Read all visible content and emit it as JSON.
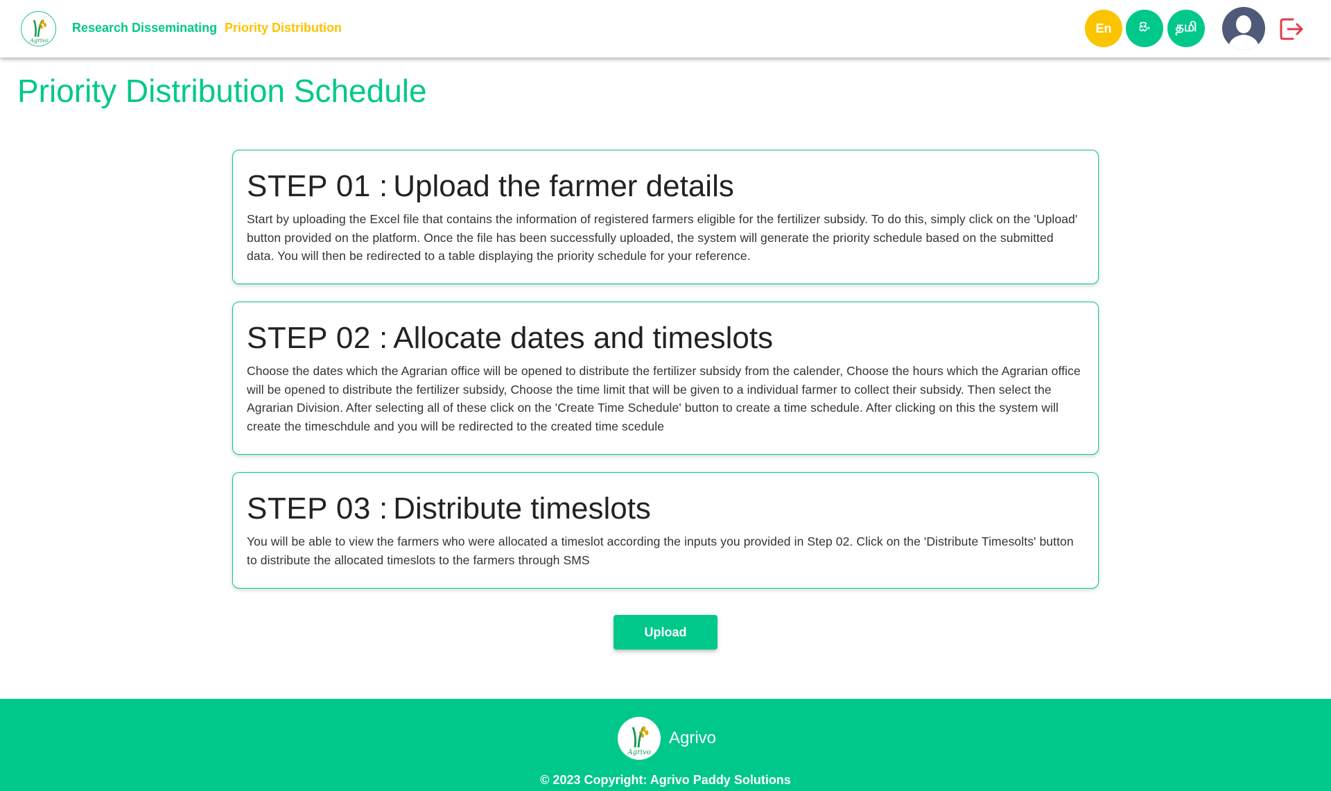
{
  "colors": {
    "brand_green": "#00c88a",
    "accent_yellow": "#fbc400",
    "text_dark": "#222222",
    "logout_red": "#e03c4a",
    "avatar_bg": "#4e5a78"
  },
  "header": {
    "logo_icon": "agrivo-logo-icon",
    "logo_text": "Agrivo",
    "nav": {
      "research": "Research Disseminating",
      "priority": "Priority Distribution"
    },
    "languages": {
      "en": "En",
      "si": "සිං",
      "ta": "தமி"
    },
    "avatar_icon": "user-avatar-icon",
    "logout_icon": "logout-icon"
  },
  "page": {
    "title": "Priority Distribution Schedule"
  },
  "steps": [
    {
      "number": "STEP 01",
      "colon": ":",
      "title": "Upload the farmer details",
      "text": "Start by uploading the Excel file that contains the information of registered farmers eligible for the fertilizer subsidy. To do this, simply click on the 'Upload' button provided on the platform. Once the file has been successfully uploaded, the system will generate the priority schedule based on the submitted data. You will then be redirected to a table displaying the priority schedule for your reference."
    },
    {
      "number": "STEP 02",
      "colon": ":",
      "title": "Allocate dates and timeslots",
      "text": "Choose the dates which the Agrarian office will be opened to distribute the fertilizer subsidy from the calender, Choose the hours which the Agrarian office will be opened to distribute the fertilizer subsidy, Choose the time limit that will be given to a individual farmer to collect their subsidy. Then select the Agrarian Division. After selecting all of these click on the 'Create Time Schedule' button to create a time schedule. After clicking on this the system will create the timeschdule and you will be redirected to the created time scedule"
    },
    {
      "number": "STEP 03",
      "colon": ":",
      "title": "Distribute timeslots",
      "text": "You will be able to view the farmers who were allocated a timeslot according the inputs you provided in Step 02. Click on the 'Distribute Timesolts' button to distribute the allocated timeslots to the farmers through SMS"
    }
  ],
  "upload_button": {
    "label": "Upload"
  },
  "footer": {
    "brand": "Agrivo",
    "copyright": "© 2023 Copyright: Agrivo Paddy Solutions"
  }
}
